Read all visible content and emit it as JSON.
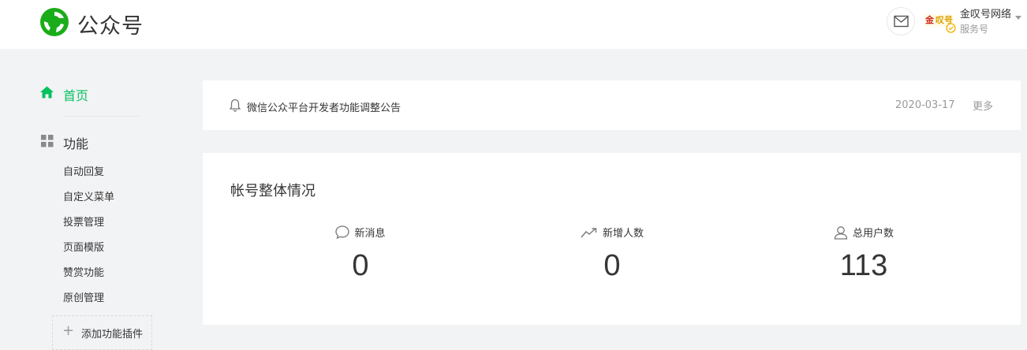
{
  "header": {
    "brand": "公众号",
    "account_name": "金叹号网络",
    "account_type": "服务号",
    "avatar_text_left": "金",
    "avatar_text_right": "叹号"
  },
  "sidebar": {
    "home_label": "首页",
    "func_label": "功能",
    "sub_items": [
      "自动回复",
      "自定义菜单",
      "投票管理",
      "页面模版",
      "赞赏功能",
      "原创管理"
    ],
    "add_plugin_label": "添加功能插件"
  },
  "notice": {
    "text": "微信公众平台开发者功能调整公告",
    "date": "2020-03-17",
    "more": "更多"
  },
  "overview": {
    "title": "帐号整体情况",
    "stats": [
      {
        "label": "新消息",
        "value": "0",
        "icon": "message-icon"
      },
      {
        "label": "新增人数",
        "value": "0",
        "icon": "trend-icon"
      },
      {
        "label": "总用户数",
        "value": "113",
        "icon": "user-icon"
      }
    ]
  },
  "colors": {
    "accent": "#07c160",
    "background": "#f2f3f5",
    "text": "#353535",
    "muted": "#9a9a9a"
  }
}
